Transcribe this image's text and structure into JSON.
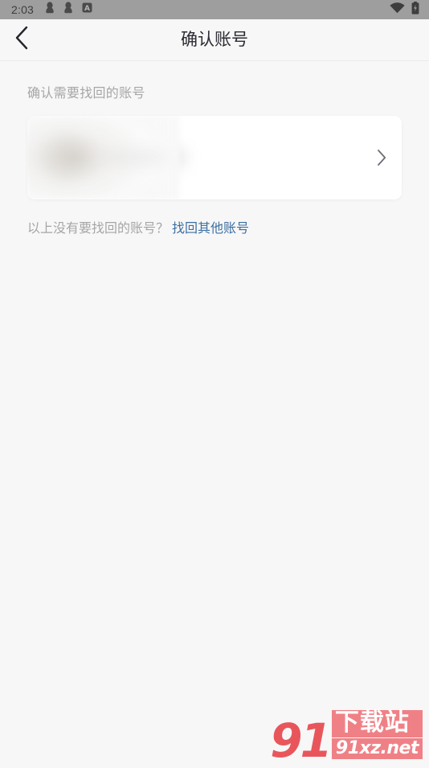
{
  "status_bar": {
    "time": "2:03",
    "left_icons": [
      "qq-notification-icon",
      "qq-notification-icon",
      "letter-a-badge-icon"
    ],
    "right_icons": [
      "wifi-icon",
      "battery-charging-icon"
    ],
    "background_color": "#9e9e9e"
  },
  "appbar": {
    "back_icon": "chevron-left-icon",
    "title": "确认账号"
  },
  "main": {
    "section_label": "确认需要找回的账号",
    "account_card": {
      "avatar": "redacted-avatar",
      "nickname": "",
      "nickname_redacted": true,
      "chevron_icon": "chevron-right-icon"
    },
    "footer_prompt": "以上没有要找回的账号？",
    "footer_link": "找回其他账号",
    "link_color": "#3c6fa3"
  },
  "watermark": {
    "logo_number": "91",
    "cn_text": "下载站",
    "url_text": "91xz.net",
    "primary_color": "#e8565c",
    "secondary_color": "#ef8186"
  }
}
